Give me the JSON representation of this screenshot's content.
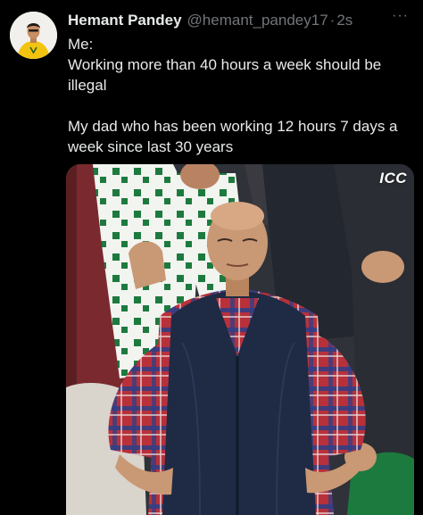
{
  "author": {
    "display_name": "Hemant Pandey",
    "handle": "@hemant_pandey17",
    "separator": "·",
    "time_ago": "2s"
  },
  "more_menu": {
    "icon": "more-horizontal-icon",
    "label": "···"
  },
  "tweet": {
    "line_1": "Me:",
    "line_2": "Working more than 40 hours a week should be illegal",
    "line_3": "My dad who has been working 12 hours 7 days a week since last 30 years"
  },
  "media": {
    "watermark": "ICC",
    "colors": {
      "vest": "#1f2a44",
      "shirt_red": "#b8313a",
      "shirt_blue": "#2e3e86",
      "crowd_green": "#1d7a3f",
      "skin": "#c99874"
    }
  },
  "colors": {
    "background": "#000000",
    "text_primary": "#e7e9ea",
    "text_secondary": "#71767b"
  }
}
